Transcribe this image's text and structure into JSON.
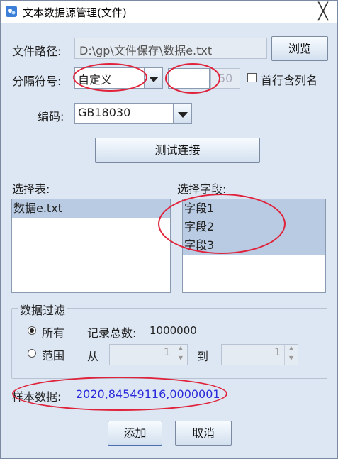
{
  "window": {
    "title": "文本数据源管理(文件)",
    "close_glyph": "╳"
  },
  "file": {
    "path_label": "文件路径:",
    "path_value": "D:\\gp\\文件保存\\数据e.txt",
    "browse_label": "浏览"
  },
  "separator": {
    "label": "分隔符号:",
    "selected": "自定义",
    "custom_value": "",
    "length_value": "50",
    "first_row_label": "首行含列名"
  },
  "encoding": {
    "label": "编码:",
    "selected": "GB18030"
  },
  "test_button": "测试连接",
  "tables": {
    "label": "选择表:",
    "items": [
      "数据e.txt"
    ]
  },
  "fields": {
    "label": "选择字段:",
    "items": [
      "字段1",
      "字段2",
      "字段3"
    ]
  },
  "filter": {
    "label": "数据过滤",
    "all_label": "所有",
    "total_label": "记录总数:",
    "total_value": "1000000",
    "range_label": "范围",
    "from_label": "从",
    "from_value": "1",
    "to_label": "到",
    "to_value": "1"
  },
  "sample": {
    "label": "样本数据:",
    "value": "2020,84549116,0000001"
  },
  "buttons": {
    "add": "添加",
    "cancel": "取消"
  },
  "colors": {
    "accent_blue": "#2a2adb",
    "annotation_red": "#e0223a",
    "selection": "#b8cbe3"
  }
}
